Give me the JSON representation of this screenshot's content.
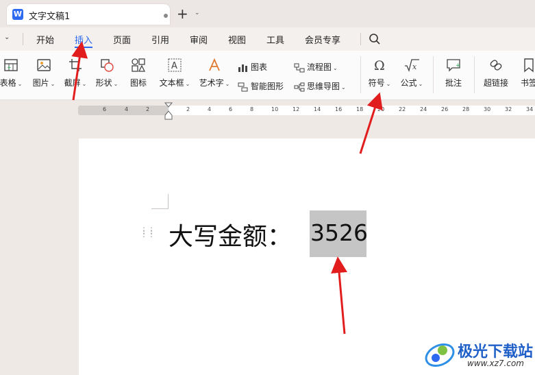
{
  "tab": {
    "title": "文字文稿1",
    "logo": "W"
  },
  "menu": {
    "items": [
      "开始",
      "插入",
      "页面",
      "引用",
      "审阅",
      "视图",
      "工具",
      "会员专享"
    ],
    "active_index": 1
  },
  "ribbon": {
    "table": "表格",
    "picture": "图片",
    "screenshot": "截屏",
    "shape": "形状",
    "icon": "图标",
    "textbox": "文本框",
    "wordart": "艺术字",
    "chart": "图表",
    "smartart": "智能图形",
    "flowchart": "流程图",
    "mindmap": "思维导图",
    "symbol": "符号",
    "formula": "公式",
    "comment": "批注",
    "hyperlink": "超链接",
    "bookmark": "书签"
  },
  "ruler": {
    "left_ticks": [
      "6",
      "4",
      "2"
    ],
    "right_ticks": [
      "2",
      "4",
      "6",
      "8",
      "10",
      "12",
      "14",
      "16",
      "18",
      "20",
      "22",
      "24",
      "26",
      "28",
      "30",
      "32",
      "34"
    ]
  },
  "document": {
    "label": "大写金额：",
    "amount": "3526"
  },
  "watermark": {
    "name": "极光下载站",
    "url": "www.xz7.com"
  },
  "colors": {
    "accent": "#2e6af0",
    "arrow": "#e21d1d",
    "highlight": "#c5c5c5"
  }
}
